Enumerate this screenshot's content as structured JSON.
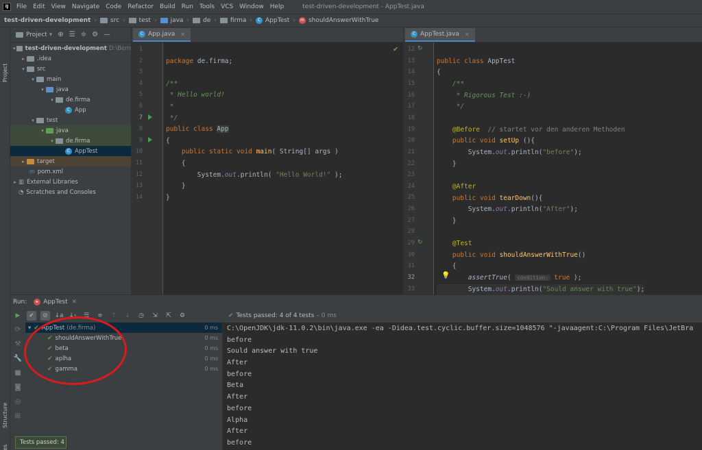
{
  "menubar": {
    "logo": "IJ",
    "items": [
      "File",
      "Edit",
      "View",
      "Navigate",
      "Code",
      "Refactor",
      "Build",
      "Run",
      "Tools",
      "VCS",
      "Window",
      "Help"
    ],
    "title": "test-driven-development - AppTest.java"
  },
  "navbar": {
    "crumbs": [
      "test-driven-development",
      "src",
      "test",
      "java",
      "de",
      "firma",
      "AppTest",
      "shouldAnswerWithTrue"
    ]
  },
  "sidebar": {
    "project_label": "Project",
    "structure_label": "Structure",
    "favorites_label": "Favorites"
  },
  "project": {
    "title": "Project",
    "tree": [
      {
        "label": "test-driven-development",
        "extra": "D:\\Bern",
        "bold": true
      },
      {
        "label": ".idea"
      },
      {
        "label": "src"
      },
      {
        "label": "main"
      },
      {
        "label": "java"
      },
      {
        "label": "de.firma"
      },
      {
        "label": "App"
      },
      {
        "label": "test"
      },
      {
        "label": "java"
      },
      {
        "label": "de.firma"
      },
      {
        "label": "AppTest"
      },
      {
        "label": "target"
      },
      {
        "label": "pom.xml"
      },
      {
        "label": "External Libraries"
      },
      {
        "label": "Scratches and Consoles"
      }
    ]
  },
  "editor1": {
    "tab": "App.java",
    "line_numbers": [
      "1",
      "2",
      "3",
      "4",
      "5",
      "6",
      "7",
      "8",
      "9",
      "10",
      "11",
      "12",
      "13",
      "14"
    ],
    "code": {
      "l1_kw": "package",
      "l1_rest": " de.firma;",
      "l3": "/**",
      "l4": " * Hello world!",
      "l5": " *",
      "l6": " */",
      "l7_kw": "public class ",
      "l7_cls": "App",
      "l8": "{",
      "l9_kw": "    public static void ",
      "l9_fn": "main",
      "l9_rest": "( String[] args )",
      "l10": "    {",
      "l11_a": "        System.",
      "l11_out": "out",
      "l11_b": ".println( ",
      "l11_str": "\"Hello World!\"",
      "l11_c": " );",
      "l12": "    }",
      "l13": "}"
    }
  },
  "editor2": {
    "tab": "AppTest.java",
    "line_numbers": [
      "12",
      "13",
      "14",
      "15",
      "16",
      "17",
      "18",
      "19",
      "20",
      "21",
      "22",
      "23",
      "24",
      "25",
      "26",
      "27",
      "28",
      "29",
      "30",
      "31",
      "32",
      "33"
    ],
    "code": {
      "l12_kw": "public class ",
      "l12_cls": "AppTest",
      "l13": "{",
      "l14": "    /**",
      "l15": "     * Rigorous Test :-)",
      "l16": "     */",
      "l18_an": "    @Before",
      "l18_cm": "  // startet vor den anderen Methoden",
      "l19_kw": "    public void ",
      "l19_fn": "setUp",
      "l19_rest": " (){",
      "l20_a": "        System.",
      "l20_out": "out",
      "l20_b": ".println(",
      "l20_str": "\"before\"",
      "l20_c": ");",
      "l21": "    }",
      "l23_an": "    @After",
      "l24_kw": "    public void ",
      "l24_fn": "tearDown",
      "l24_rest": "(){",
      "l25_str": "\"After\"",
      "l26": "    }",
      "l28_an": "    @Test",
      "l29_kw": "    public void ",
      "l29_fn": "shouldAnswerWithTrue",
      "l29_rest": "()",
      "l30": "    {",
      "l31_a": "        ",
      "l31_it": "assertTrue",
      "l31_b": "( ",
      "l31_hint": "condition:",
      "l31_kw": " true",
      "l31_c": " );",
      "l32_str": "\"Sould answer with true\"",
      "l33": "    }"
    }
  },
  "run": {
    "label": "Run:",
    "config": "AppTest",
    "status": "Tests passed:",
    "status_count": "4 of 4 tests",
    "status_time": "– 0 ms",
    "tests": [
      {
        "name": "AppTest",
        "extra": "(de.firma)",
        "time": "0 ms"
      },
      {
        "name": "shouldAnswerWithTrue",
        "time": "0 ms"
      },
      {
        "name": "beta",
        "time": "0 ms"
      },
      {
        "name": "aplha",
        "time": "0 ms"
      },
      {
        "name": "gamma",
        "time": "0 ms"
      }
    ],
    "console": [
      "C:\\OpenJDK\\jdk-11.0.2\\bin\\java.exe -ea -Didea.test.cyclic.buffer.size=1048576 \"-javaagent:C:\\Program Files\\JetBra",
      "before",
      "Sould answer with true",
      "After",
      "before",
      "Beta",
      "After",
      "before",
      "Alpha",
      "After",
      "before"
    ],
    "badge": "Tests passed: 4"
  },
  "colors": {
    "accent": "#4a88c7",
    "pass": "#5f9e54",
    "annotation_circle": "#d81c1c"
  }
}
